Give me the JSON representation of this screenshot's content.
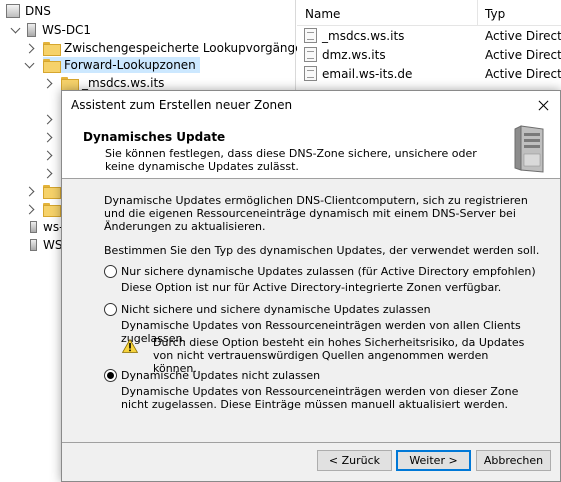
{
  "tree": {
    "root": "DNS",
    "server": "WS-DC1",
    "cached_lookups": "Zwischengespeicherte Lookupvorgänge",
    "forward_zones": "Forward-Lookupzonen",
    "msdcs_child": "_msdcs.ws.its",
    "partial_item_1": "ws-",
    "partial_item_2": "WS"
  },
  "list": {
    "col_name": "Name",
    "col_type": "Typ",
    "rows": [
      {
        "name": "_msdcs.ws.its",
        "type": "Active Directory"
      },
      {
        "name": "dmz.ws.its",
        "type": "Active Directory"
      },
      {
        "name": "email.ws-its.de",
        "type": "Active Directory"
      }
    ]
  },
  "dialog": {
    "title": "Assistent zum Erstellen neuer Zonen",
    "header_title": "Dynamisches Update",
    "header_sub": "Sie können festlegen, dass diese DNS-Zone sichere, unsichere oder keine dynamische Updates zulässt.",
    "intro": "Dynamische Updates ermöglichen DNS-Clientcomputern, sich zu registrieren und die eigenen Ressourceneinträge dynamisch mit einem DNS-Server bei Änderungen zu aktualisieren.",
    "prompt": "Bestimmen Sie den Typ des dynamischen Updates, der verwendet werden soll.",
    "options": [
      {
        "label": "Nur sichere dynamische Updates zulassen (für Active Directory empfohlen)",
        "desc": "Diese Option ist nur für Active Directory-integrierte Zonen verfügbar.",
        "checked": false
      },
      {
        "label": "Nicht sichere und sichere dynamische Updates zulassen",
        "desc": "Dynamische Updates von Ressourceneinträgen werden von allen Clients zugelassen.",
        "warning": "Durch diese Option besteht ein hohes Sicherheitsrisiko, da Updates von nicht vertrauenswürdigen Quellen angenommen werden können.",
        "checked": false
      },
      {
        "label": "Dynamische Updates nicht zulassen",
        "desc": "Dynamische Updates von Ressourceneinträgen werden von dieser Zone nicht zugelassen. Diese Einträge müssen manuell aktualisiert werden.",
        "checked": true
      }
    ],
    "buttons": {
      "back": "< Zurück",
      "next": "Weiter >",
      "cancel": "Abbrechen"
    }
  }
}
